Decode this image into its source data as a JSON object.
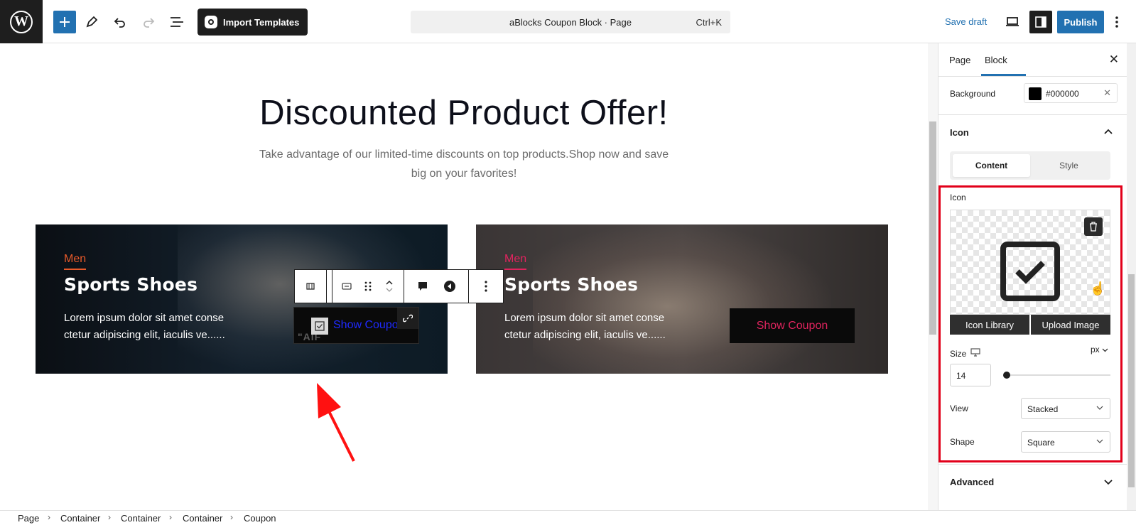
{
  "header": {
    "import_label": "Import Templates",
    "doc_title": "aBlocks Coupon Block · Page",
    "shortcut": "Ctrl+K",
    "save_draft": "Save draft",
    "publish": "Publish"
  },
  "canvas": {
    "heading": "Discounted Product Offer!",
    "subtext": "Take advantage of our limited-time discounts on top products.Shop now and save big on your favorites!",
    "cards": [
      {
        "category": "Men",
        "title": "Sports Shoes",
        "description": "Lorem ipsum dolor sit amet conse ctetur adipiscing elit, iaculis ve......",
        "button": "Show Coupon",
        "bg_text": "\"AIF"
      },
      {
        "category": "Men",
        "title": "Sports Shoes",
        "description": "Lorem ipsum dolor sit amet conse ctetur adipiscing elit, iaculis ve......",
        "button": "Show Coupon"
      }
    ]
  },
  "sidebar": {
    "tabs": [
      "Page",
      "Block"
    ],
    "active_tab": "Block",
    "background_label": "Background",
    "background_value": "#000000",
    "icon_panel_title": "Icon",
    "segment": [
      "Content",
      "Style"
    ],
    "icon_field_label": "Icon",
    "icon_library": "Icon Library",
    "upload_image": "Upload Image",
    "size_label": "Size",
    "size_unit": "px",
    "size_value": "14",
    "size_fraction": 0.0,
    "view_label": "View",
    "view_value": "Stacked",
    "shape_label": "Shape",
    "shape_value": "Square",
    "advanced_title": "Advanced"
  },
  "breadcrumbs": [
    "Page",
    "Container",
    "Container",
    "Container",
    "Coupon"
  ],
  "colors": {
    "accent": "#2271b1",
    "highlight_box": "#e2001a",
    "category_card1": "#e85a2a",
    "category_card2": "#e0245e",
    "coupon_text": "#e0245e",
    "selected_coupon_text": "#1f2aff"
  },
  "icons": [
    "wordpress-logo-icon",
    "plus-icon",
    "pen-icon",
    "undo-icon",
    "redo-icon",
    "list-view-icon",
    "desktop-view-icon",
    "sidebar-toggle-icon",
    "more-vertical-icon",
    "close-icon",
    "chevron-up-icon",
    "chevron-down-icon",
    "trash-icon",
    "checkbox-icon",
    "link-icon",
    "drag-handle-icon",
    "comment-icon",
    "cursor-hand-icon"
  ]
}
